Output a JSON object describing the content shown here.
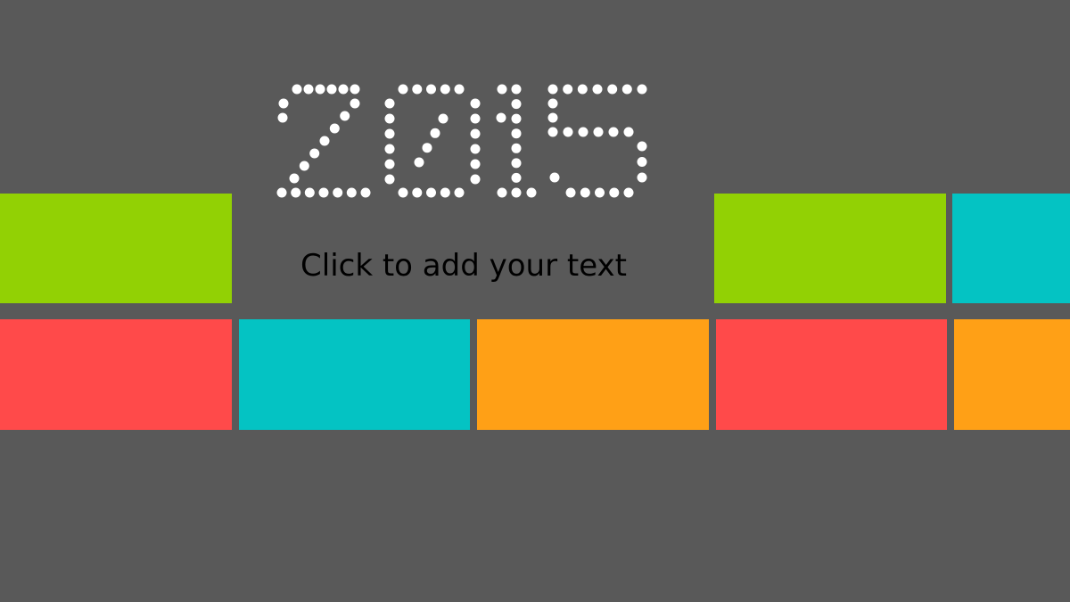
{
  "slide": {
    "background": "#595959",
    "headline": "2015",
    "subtitle_placeholder": "Click to add your text",
    "subtitle_color": "#000000",
    "dot_color": "#ffffff"
  },
  "palette": {
    "green": "#92d104",
    "teal": "#04c3c3",
    "orange": "#ffa016",
    "red": "#ff4a4a"
  },
  "tiles": {
    "row1": [
      "green",
      "green",
      "teal"
    ],
    "row2": [
      "red",
      "teal",
      "orange",
      "red",
      "orange"
    ]
  }
}
